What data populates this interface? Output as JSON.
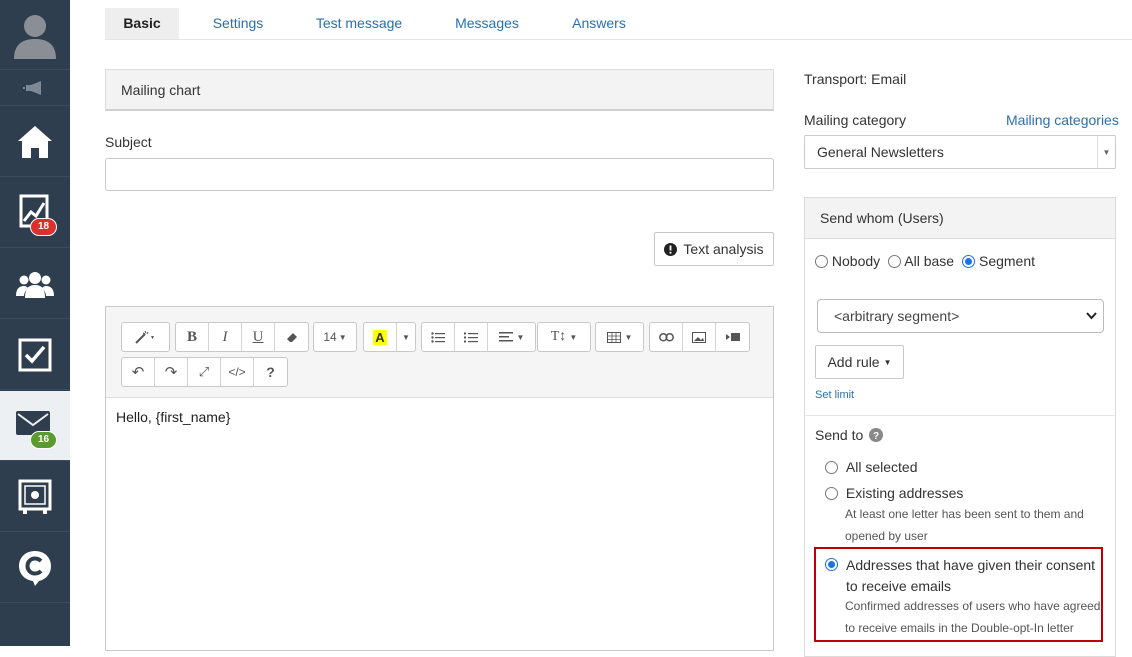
{
  "sidebar": {
    "badges": {
      "analytics": "18",
      "mail": "16"
    }
  },
  "tabs": [
    "Basic",
    "Settings",
    "Test message",
    "Messages",
    "Answers"
  ],
  "main": {
    "panel_title": "Mailing chart",
    "subject_label": "Subject",
    "subject_value": "",
    "text_analysis": "Text analysis",
    "font_size": "14",
    "editor_content": "Hello, {first_name}"
  },
  "right": {
    "transport": "Transport: Email",
    "category_label": "Mailing category",
    "category_link": "Mailing categories",
    "category_value": "General Newsletters",
    "send_whom_title": "Send whom (Users)",
    "whom_options": [
      "Nobody",
      "All base",
      "Segment"
    ],
    "segment_value": "<arbitrary segment>",
    "add_rule": "Add rule",
    "set_limit": "Set limit",
    "send_to_label": "Send to",
    "send_to_options": [
      {
        "label": "All selected",
        "note": ""
      },
      {
        "label": "Existing addresses",
        "note": "At least one letter has been sent to them and opened by user"
      },
      {
        "label": "Addresses that have given their consent to receive emails",
        "note": "Confirmed addresses of users who have agreed to receive emails in the Double-opt-In letter"
      }
    ]
  },
  "colors": {
    "sidebar": "#2f3e4e",
    "link": "#2a6fae",
    "highlight": "#c00000",
    "accent": "#1a73e8"
  }
}
